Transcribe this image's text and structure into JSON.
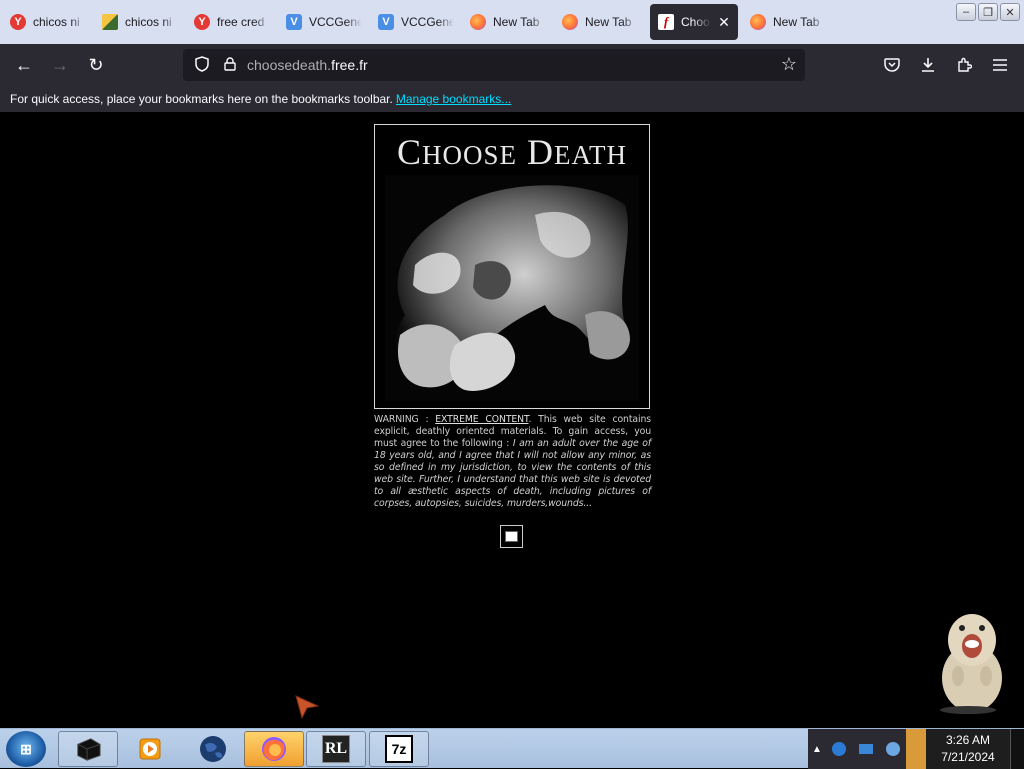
{
  "tabs": [
    {
      "label": "chicos ni",
      "icon": "yandex-icon",
      "kind": "y"
    },
    {
      "label": "chicos ni",
      "icon": "image-icon",
      "kind": "img"
    },
    {
      "label": "free cred",
      "icon": "yandex-icon",
      "kind": "y"
    },
    {
      "label": "VCCGene",
      "icon": "vcc-icon",
      "kind": "v"
    },
    {
      "label": "VCCGene",
      "icon": "vcc-icon",
      "kind": "v"
    },
    {
      "label": "New Tab",
      "icon": "firefox-icon",
      "kind": "ff"
    },
    {
      "label": "New Tab",
      "icon": "firefox-icon",
      "kind": "ff"
    },
    {
      "label": "Choos",
      "icon": "flash-icon",
      "kind": "flash",
      "active": true
    },
    {
      "label": "New Tab",
      "icon": "firefox-icon",
      "kind": "ff"
    }
  ],
  "window": {
    "minimize": "–",
    "maximize": "❐",
    "close": "✕"
  },
  "nav": {
    "back": "←",
    "forward": "→",
    "reload": "↻",
    "url_prefix": "choosedeath.",
    "url_host": "free.fr",
    "star": "☆"
  },
  "bookmarks": {
    "text": "For quick access, place your bookmarks here on the bookmarks toolbar.",
    "link": "Manage bookmarks..."
  },
  "page": {
    "title_first_initial": "C",
    "title_first_rest": "HOOSE",
    "title_second_initial": "D",
    "title_second_rest": "EATH",
    "warning_prefix": "WARNING : ",
    "warning_highlight": "EXTREME CONTENT",
    "warning_body": ". This web site contains explicit, deathly oriented materials. To gain access, you must agree to the following : ",
    "warning_italic": "I am an adult over the age of 18 years old, and I agree that I will not allow any minor, as so defined in my jurisdiction, to view the contents of this web site. Further, I understand that this web site is devoted to all æsthetic aspects of death, including pictures of corpses, autopsies, suicides, murders,wounds..."
  },
  "taskbar": {
    "time": "3:26 AM",
    "date": "7/21/2024",
    "apps": [
      "windows-start-icon",
      "black-box-icon",
      "media-player-icon",
      "globe-icon",
      "firefox-icon",
      "rl-icon",
      "7zip-icon"
    ],
    "app_labels": {
      "rl": "RL",
      "zip": "7z"
    }
  }
}
